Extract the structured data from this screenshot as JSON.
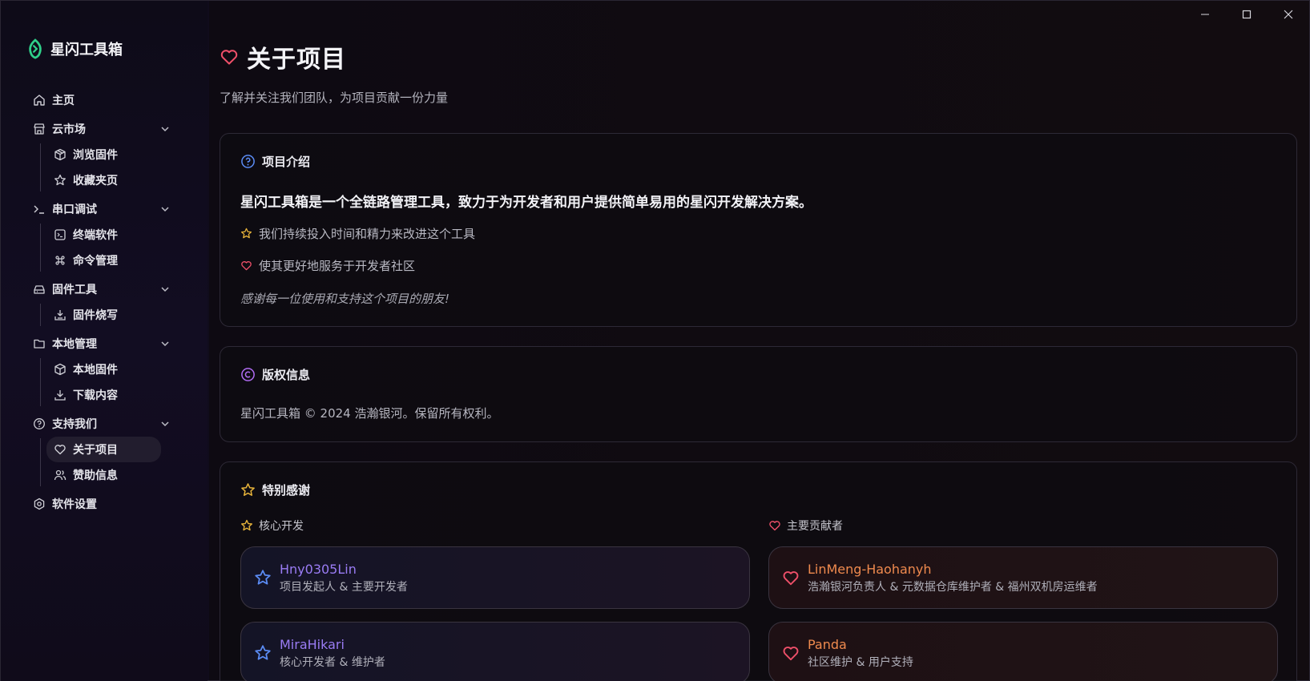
{
  "app": {
    "name": "星闪工具箱"
  },
  "window_controls": {
    "minimize": "minimize-icon",
    "maximize": "maximize-icon",
    "close": "close-icon"
  },
  "sidebar": {
    "home": "主页",
    "groups": [
      {
        "label": "云市场",
        "icon": "store-icon",
        "children": [
          {
            "label": "浏览固件",
            "icon": "package-icon"
          },
          {
            "label": "收藏夹页",
            "icon": "star-icon"
          }
        ]
      },
      {
        "label": "串口调试",
        "icon": "terminal-icon",
        "children": [
          {
            "label": "终端软件",
            "icon": "terminal-square-icon"
          },
          {
            "label": "命令管理",
            "icon": "command-icon"
          }
        ]
      },
      {
        "label": "固件工具",
        "icon": "drive-icon",
        "children": [
          {
            "label": "固件烧写",
            "icon": "flash-download-icon"
          }
        ]
      },
      {
        "label": "本地管理",
        "icon": "folder-icon",
        "children": [
          {
            "label": "本地固件",
            "icon": "box-icon"
          },
          {
            "label": "下载内容",
            "icon": "download-icon"
          }
        ]
      },
      {
        "label": "支持我们",
        "icon": "help-circle-icon",
        "children": [
          {
            "label": "关于项目",
            "icon": "heart-icon",
            "active": true
          },
          {
            "label": "赞助信息",
            "icon": "users-icon"
          }
        ]
      }
    ],
    "settings": "软件设置"
  },
  "page": {
    "title": "关于项目",
    "subtitle": "了解并关注我们团队，为项目贡献一份力量"
  },
  "intro": {
    "heading": "项目介绍",
    "lead": "星闪工具箱是一个全链路管理工具，致力于为开发者和用户提供简单易用的星闪开发解决方案。",
    "point1": "我们持续投入时间和精力来改进这个工具",
    "point2": "使其更好地服务于开发者社区",
    "thanks": "感谢每一位使用和支持这个项目的朋友!"
  },
  "copyright": {
    "heading": "版权信息",
    "text": "星闪工具箱 © 2024 浩瀚银河。保留所有权利。"
  },
  "credits": {
    "heading": "特别感谢",
    "core_label": "核心开发",
    "contrib_label": "主要贡献者",
    "core": [
      {
        "name": "Hny0305Lin",
        "role": "项目发起人 & 主要开发者"
      },
      {
        "name": "MiraHikari",
        "role": "核心开发者 & 维护者"
      }
    ],
    "contributors": [
      {
        "name": "LinMeng-Haohanyh",
        "role": "浩瀚银河负责人 & 元数据仓库维护者 & 福州双机房运维者"
      },
      {
        "name": "Panda",
        "role": "社区维护 & 用户支持"
      }
    ]
  },
  "colors": {
    "accent_red": "#f0506a",
    "accent_gold": "#e5b23a",
    "accent_blue": "#5b8cf5",
    "accent_violet": "#b06cf3",
    "logo_green": "#2fd08a"
  }
}
